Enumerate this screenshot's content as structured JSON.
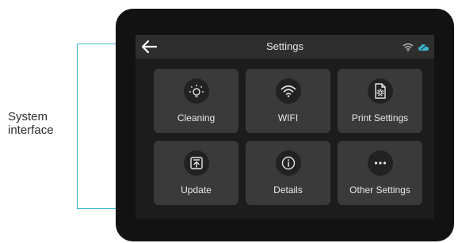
{
  "callout": {
    "label_line1": "System",
    "label_line2": "interface"
  },
  "header": {
    "title": "Settings",
    "back_icon": "back-arrow-icon",
    "status_icons": [
      "wifi-icon",
      "cloud-icon"
    ]
  },
  "tiles": [
    {
      "label": "Cleaning",
      "icon": "sun-icon"
    },
    {
      "label": "WIFI",
      "icon": "wifi-icon"
    },
    {
      "label": "Print Settings",
      "icon": "file-settings-icon"
    },
    {
      "label": "Update",
      "icon": "upload-icon"
    },
    {
      "label": "Details",
      "icon": "info-icon"
    },
    {
      "label": "Other Settings",
      "icon": "more-icon"
    }
  ],
  "colors": {
    "bracket": "#3fb6cf",
    "status_accent": "#3fb6cf"
  }
}
